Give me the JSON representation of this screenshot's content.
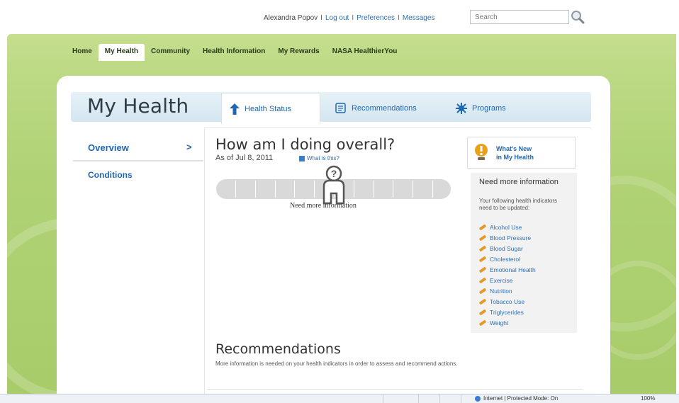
{
  "top": {
    "user_name": "Alexandra Popov",
    "links": [
      "Log out",
      "Preferences",
      "Messages"
    ],
    "search_placeholder": "Search"
  },
  "nav": {
    "items": [
      "Home",
      "My Health",
      "Community",
      "Health Information",
      "My Rewards",
      "NASA HealthierYou"
    ],
    "active": "My Health"
  },
  "page": {
    "title": "My Health",
    "tabs": [
      {
        "label": "Health Status",
        "icon": "person-arrow-icon",
        "active": true
      },
      {
        "label": "Recommendations",
        "icon": "document-icon",
        "active": false
      },
      {
        "label": "Programs",
        "icon": "burst-icon",
        "active": false
      }
    ]
  },
  "sidebar": {
    "items": [
      {
        "label": "Overview",
        "active": true
      },
      {
        "label": "Conditions",
        "active": false
      }
    ],
    "chevron": ">"
  },
  "overall": {
    "heading": "How am I doing overall?",
    "as_of": "As of Jul 8, 2011",
    "what_is_this": "What is this?",
    "meter_label": "Need more information",
    "meter_segments": 10
  },
  "right_panel": {
    "whats_new": [
      "What's New",
      "in My Health"
    ],
    "info_title": "Need more information",
    "info_desc": "Your following health indicators need to be updated:",
    "indicators": [
      "Alcohol Use",
      "Blood Pressure",
      "Blood Sugar",
      "Cholesterol",
      "Emotional Health",
      "Exercise",
      "Nutrition",
      "Tobacco Use",
      "Triglycerides",
      "Weight"
    ]
  },
  "recommendations": {
    "heading": "Recommendations",
    "text": "More information is needed on your health indicators in order to assess and recommend actions."
  },
  "statusbar": {
    "zone": "Internet | Protected Mode: On",
    "zoom": "100%"
  },
  "colors": {
    "link": "#1f67b1",
    "green_band": "#b0d275",
    "header_band": "#d4e6f1",
    "meter": "#d9d9d9",
    "pencil": "#e39a2a",
    "alert": "#e8a21a"
  }
}
